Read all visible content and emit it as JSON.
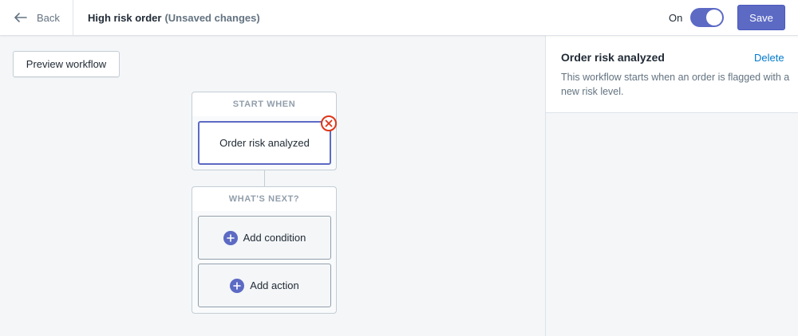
{
  "header": {
    "back_label": "Back",
    "title": "High risk order",
    "title_status": "(Unsaved changes)",
    "toggle_label": "On",
    "save_label": "Save"
  },
  "toolbar": {
    "preview_label": "Preview workflow"
  },
  "workflow": {
    "start_header": "START WHEN",
    "trigger_label": "Order risk analyzed",
    "next_header": "WHAT'S NEXT?",
    "add_condition_label": "Add condition",
    "add_action_label": "Add action"
  },
  "sidebar": {
    "title": "Order risk analyzed",
    "delete_label": "Delete",
    "description": "This workflow starts when an order is flagged with a new risk level."
  },
  "colors": {
    "accent": "#5c6ac4",
    "link": "#007ace",
    "danger": "#de3618"
  },
  "icons": {
    "back": "arrow-left-icon",
    "remove": "close-circle-icon",
    "add": "plus-circle-icon"
  }
}
